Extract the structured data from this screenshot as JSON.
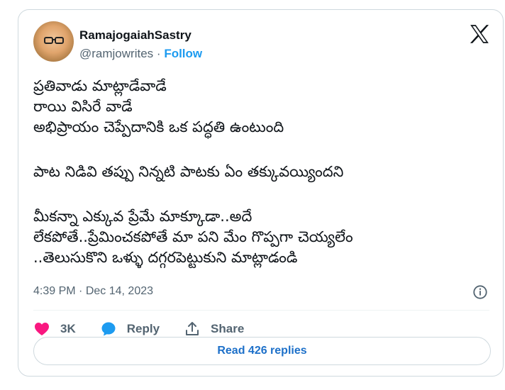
{
  "author": {
    "name": "RamajogaiahSastry",
    "handle": "@ramjowrites",
    "separator": "·",
    "follow_label": "Follow"
  },
  "tweet": {
    "lines": [
      "ప్రతివాడు మాట్లాడేవాడే",
      "రాయి విసిరే వాడే",
      "అభిప్రాయం చెప్పేదానికి ఒక పద్ధతి ఉంటుంది",
      "",
      "పాట నిడివి తప్పు నిన్నటి పాటకు ఏం తక్కువయ్యిందని",
      "",
      "మీకన్నా ఎక్కువ ప్రేమే మాక్కూడా..అదే",
      "లేకపోతే..ప్రేమించకపోతే మా పని మేం గొప్పగా చెయ్యలేం",
      "..తెలుసుకొని ఒళ్ళు దగ్గరపెట్టుకుని మాట్లాడండి"
    ],
    "time": "4:39 PM",
    "date": "Dec 14, 2023"
  },
  "actions": {
    "likes_count": "3K",
    "reply_label": "Reply",
    "share_label": "Share"
  },
  "read_replies_label": "Read 426 replies",
  "colors": {
    "accent": "#1d9bf0",
    "like": "#f91880",
    "reply_icon": "#1d9bf0",
    "text": "#0f1419",
    "muted": "#536471",
    "border": "#cfd9de"
  },
  "icons": [
    "x-logo-icon",
    "info-icon",
    "heart-icon",
    "reply-bubble-icon",
    "share-icon"
  ]
}
